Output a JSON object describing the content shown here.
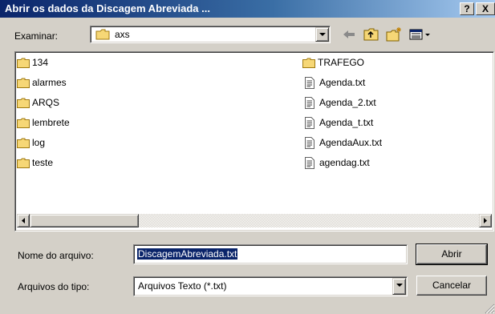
{
  "window": {
    "title": "Abrir os dados da Discagem Abreviada ...",
    "help_label": "?",
    "close_label": "X"
  },
  "lookin": {
    "label": "Examinar:",
    "value": "axs"
  },
  "files_left": [
    {
      "name": "134",
      "type": "folder"
    },
    {
      "name": "alarmes",
      "type": "folder"
    },
    {
      "name": "ARQS",
      "type": "folder"
    },
    {
      "name": "lembrete",
      "type": "folder"
    },
    {
      "name": "log",
      "type": "folder"
    },
    {
      "name": "teste",
      "type": "folder"
    }
  ],
  "files_right": [
    {
      "name": "TRAFEGO",
      "type": "folder"
    },
    {
      "name": "Agenda.txt",
      "type": "text"
    },
    {
      "name": "Agenda_2.txt",
      "type": "text"
    },
    {
      "name": "Agenda_t.txt",
      "type": "text"
    },
    {
      "name": "AgendaAux.txt",
      "type": "text"
    },
    {
      "name": "agendag.txt",
      "type": "text"
    }
  ],
  "filename": {
    "label": "Nome do arquivo:",
    "value": "DiscagemAbreviada.txt"
  },
  "filetype": {
    "label": "Arquivos do tipo:",
    "value": "Arquivos Texto (*.txt)"
  },
  "buttons": {
    "open": "Abrir",
    "cancel": "Cancelar"
  },
  "colors": {
    "title_start": "#0a246a",
    "title_end": "#a6caf0",
    "selection": "#0a246a",
    "face": "#d4d0c8",
    "folder": "#f6d776"
  }
}
